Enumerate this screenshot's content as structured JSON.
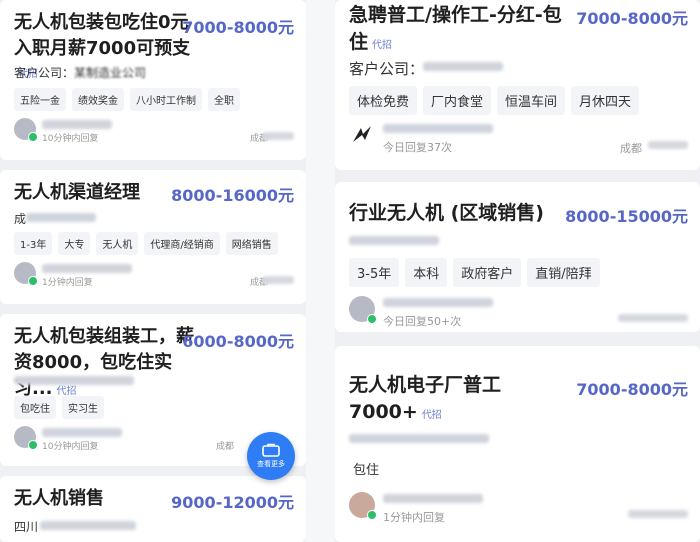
{
  "left_jobs": [
    {
      "title": "无人机包装包吃住0元入职月薪7000可预支",
      "proxy": "代招",
      "salary": "7000-8000元",
      "company_label": "客户公司：",
      "company_name": "某制造业公司",
      "tags": [
        "五险一金",
        "绩效奖金",
        "八小时工作制",
        "全职"
      ],
      "reply": "10分钟内回复",
      "location": "成都"
    },
    {
      "title": "无人机渠道经理",
      "proxy": "",
      "salary": "8000-16000元",
      "company_label": "成",
      "company_name": "",
      "tags": [
        "1-3年",
        "大专",
        "无人机",
        "代理商/经销商",
        "网络销售"
      ],
      "reply": "1分钟内回复",
      "location": "成都"
    },
    {
      "title": "无人机包装组装工，薪资8000，包吃住实习...",
      "proxy": "代招",
      "salary": "6000-8000元",
      "company_label": "",
      "company_name": "",
      "tags": [
        "包吃住",
        "实习生"
      ],
      "reply": "10分钟内回复",
      "location": "成都"
    },
    {
      "title": "无人机销售",
      "proxy": "",
      "salary": "9000-12000元",
      "company_label": "四川",
      "company_name": "",
      "tags": [],
      "reply": "",
      "location": ""
    }
  ],
  "right_jobs": [
    {
      "title": "急聘普工/操作工-分红-包住",
      "proxy": "代招",
      "salary": "7000-8000元",
      "company_label": "客户公司：",
      "tags": [
        "体检免费",
        "厂内食堂",
        "恒温车间",
        "月休四天"
      ],
      "reply": "今日回复37次",
      "location": "成都"
    },
    {
      "title": "行业无人机 (区域销售)",
      "proxy": "",
      "salary": "8000-15000元",
      "company_label": "",
      "tags": [
        "3-5年",
        "本科",
        "政府客户",
        "直销/陪拜"
      ],
      "reply": "今日回复50+次",
      "location": ""
    },
    {
      "title": "无人机电子厂普工7000+",
      "proxy": "代招",
      "salary": "7000-8000元",
      "company_label": "",
      "tags": [
        "包住"
      ],
      "reply": "1分钟内回复",
      "location": ""
    }
  ],
  "fab": {
    "label": "查看更多"
  }
}
